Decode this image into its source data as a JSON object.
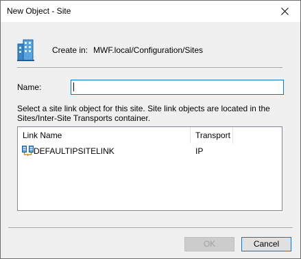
{
  "window": {
    "title": "New Object - Site",
    "close_glyph": "✕"
  },
  "header": {
    "create_in_label": "Create in:",
    "create_in_path": "MWF.local/Configuration/Sites",
    "icon": "site-icon"
  },
  "form": {
    "name_label": "Name:",
    "name_value": "",
    "instructions": "Select a site link object for this site. Site link objects are located in the Sites/Inter-Site Transports container."
  },
  "site_links": {
    "columns": [
      "Link Name",
      "Transport"
    ],
    "rows": [
      {
        "link_name": "DEFAULTIPSITELINK",
        "transport": "IP",
        "icon": "site-link-icon"
      }
    ]
  },
  "buttons": {
    "ok_label": "OK",
    "ok_enabled": false,
    "cancel_label": "Cancel"
  },
  "colors": {
    "focus_accent": "#0078d7",
    "dialog_bg": "#f0f0f0"
  }
}
